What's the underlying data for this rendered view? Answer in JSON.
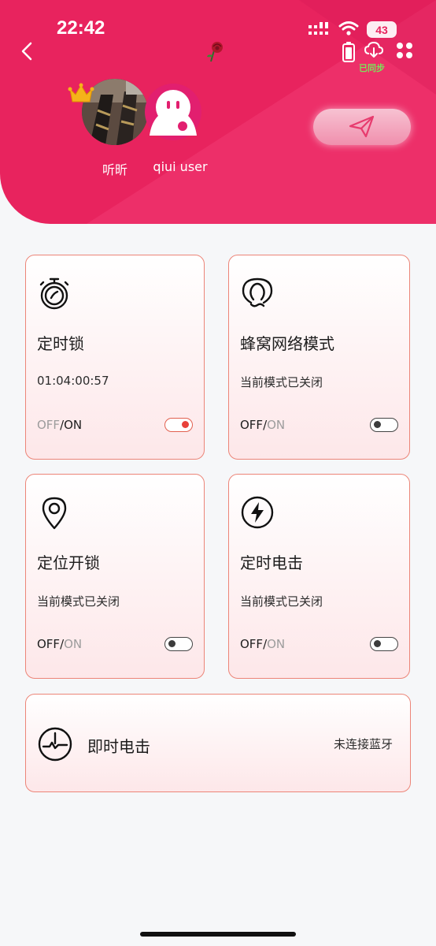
{
  "status_bar": {
    "time": "22:42",
    "battery": "43"
  },
  "header": {
    "sync_label": "已同步",
    "users": [
      {
        "name": "听昕",
        "avatar": "photo-avatar",
        "badge": "crown-icon"
      },
      {
        "name": "qiui user",
        "avatar": "default-avatar"
      }
    ],
    "send_icon": "paper-plane-icon"
  },
  "cards": [
    {
      "id": "timer-lock",
      "icon": "stopwatch-icon",
      "title": "定时锁",
      "status": "01:04:00:57",
      "off_label": "OFF",
      "separator": "/",
      "on_label": "ON",
      "state": "on"
    },
    {
      "id": "cellular-mode",
      "icon": "bulb-icon",
      "title": "蜂窝网络模式",
      "status": "当前模式已关闭",
      "off_label": "OFF",
      "separator": "/",
      "on_label": "ON",
      "state": "off"
    },
    {
      "id": "location-unlock",
      "icon": "location-pin-icon",
      "title": "定位开锁",
      "status": "当前模式已关闭",
      "off_label": "OFF",
      "separator": "/",
      "on_label": "ON",
      "state": "off"
    },
    {
      "id": "timer-shock",
      "icon": "lightning-icon",
      "title": "定时电击",
      "status": "当前模式已关闭",
      "off_label": "OFF",
      "separator": "/",
      "on_label": "ON",
      "state": "off"
    }
  ],
  "instant_shock": {
    "icon": "clock-pulse-icon",
    "title": "即时电击",
    "status": "未连接蓝牙"
  },
  "colors": {
    "header_pink": "#e8235e",
    "card_border": "#ec8578",
    "toggle_on": "#e8413a",
    "sync_green": "#7ce35a"
  }
}
